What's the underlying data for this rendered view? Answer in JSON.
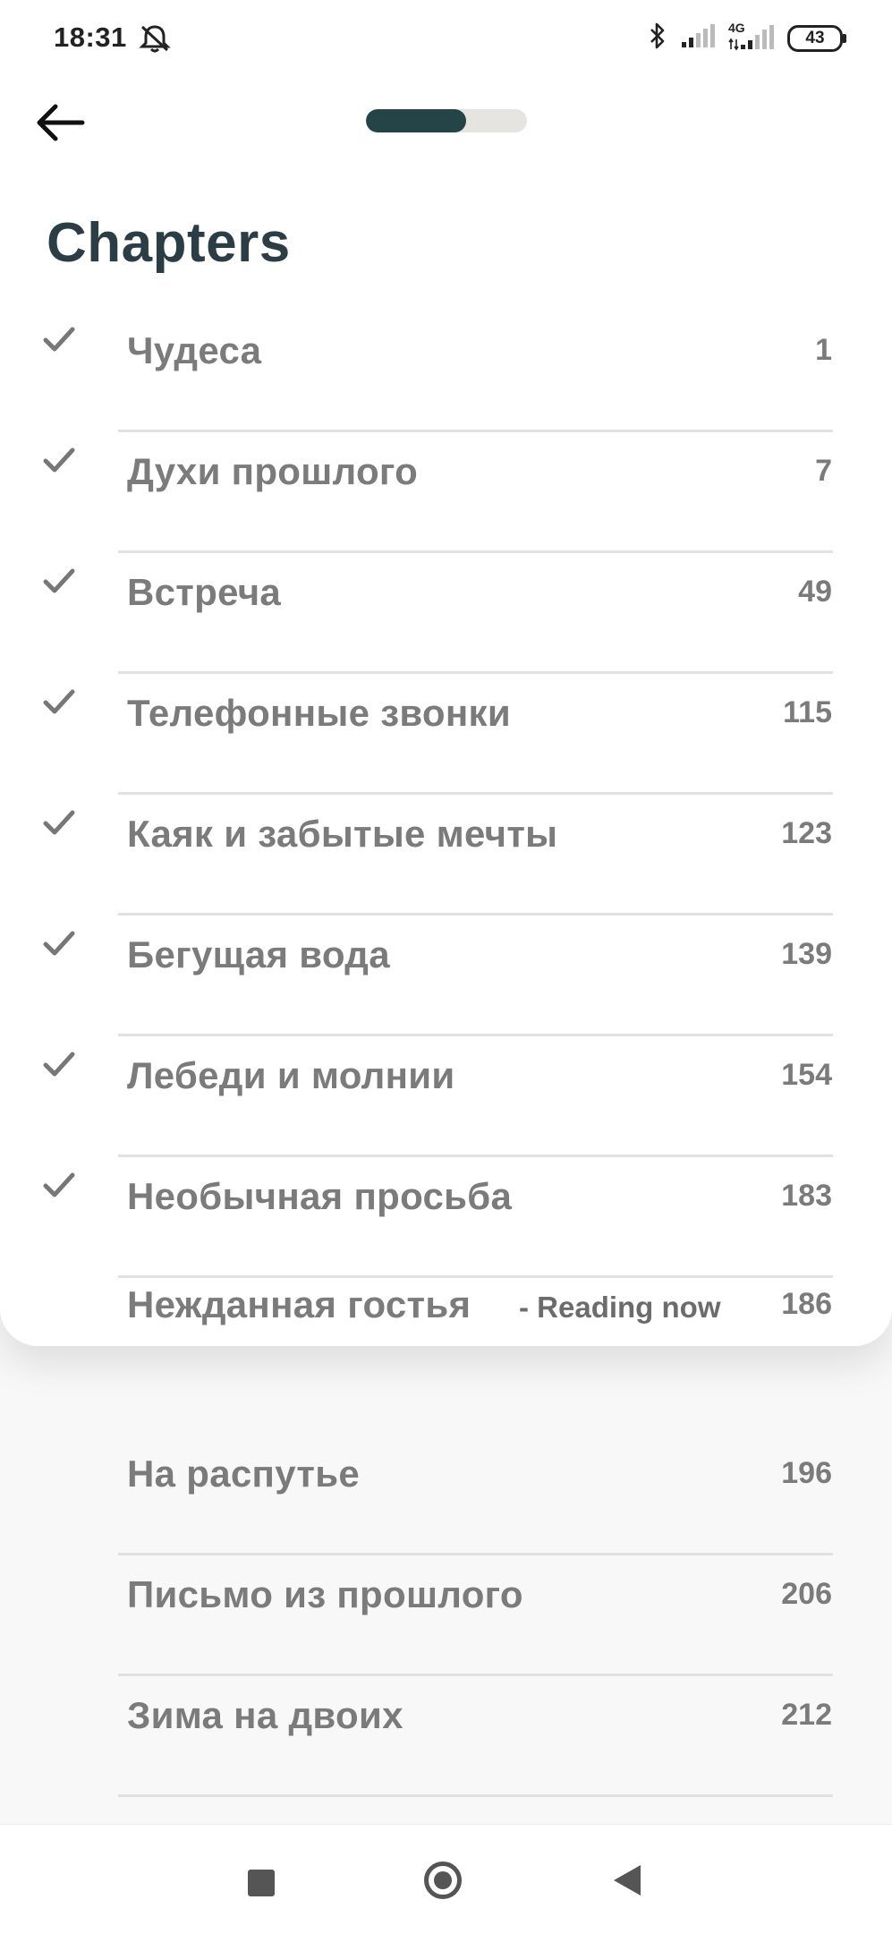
{
  "status_bar": {
    "time": "18:31",
    "network": "4G",
    "battery": "43"
  },
  "header": {
    "title": "Chapters",
    "reading_progress": 0.62
  },
  "chapters": [
    {
      "title": "Чудеса",
      "page": "1",
      "read": true
    },
    {
      "title": "Духи прошлого",
      "page": "7",
      "read": true
    },
    {
      "title": "Встреча",
      "page": "49",
      "read": true
    },
    {
      "title": "Телефонные звонки",
      "page": "115",
      "read": true
    },
    {
      "title": "Каяк и забытые мечты",
      "page": "123",
      "read": true
    },
    {
      "title": "Бегущая вода",
      "page": "139",
      "read": true
    },
    {
      "title": "Лебеди и молнии",
      "page": "154",
      "read": true
    },
    {
      "title": "Необычная просьба",
      "page": "183",
      "read": true
    },
    {
      "title": "Нежданная гостья",
      "page": "186",
      "read": false,
      "status": "- Reading now"
    },
    {
      "title": "На распутье",
      "page": "196",
      "read": false
    },
    {
      "title": "Письмо из прошлого",
      "page": "206",
      "read": false
    },
    {
      "title": "Зима на двоих",
      "page": "212",
      "read": false
    }
  ],
  "colors": {
    "accent": "#254447",
    "title": "#2c3e45",
    "text_muted": "#7b7b7b",
    "divider": "#e1e1e1"
  },
  "icons": [
    "back-arrow-icon",
    "check-icon",
    "bluetooth-icon",
    "signal-icon",
    "mute-icon",
    "battery-icon"
  ]
}
